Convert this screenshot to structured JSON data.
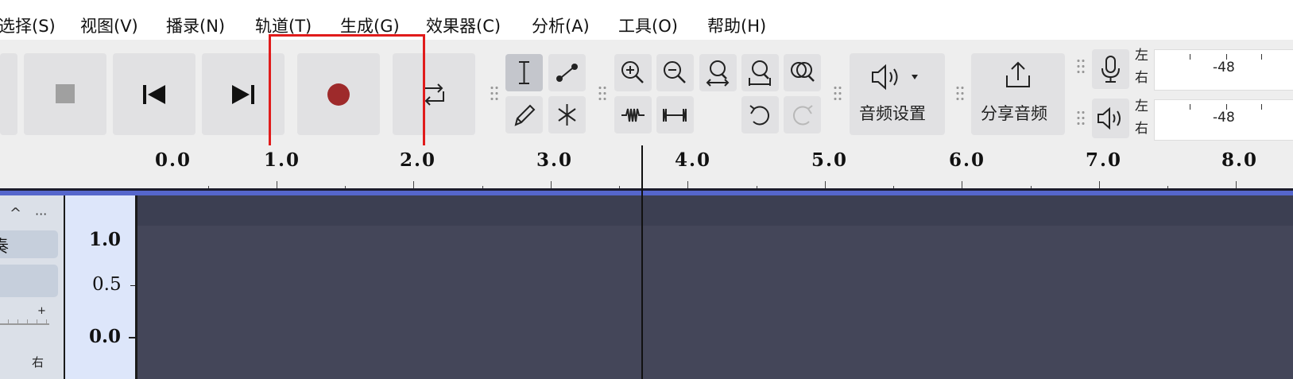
{
  "menu": {
    "items": [
      "选择(S)",
      "视图(V)",
      "播录(N)",
      "轨道(T)",
      "生成(G)",
      "效果器(C)",
      "分析(A)",
      "工具(O)",
      "帮助(H)"
    ]
  },
  "transport": {
    "buttons": [
      "stop",
      "skip-to-start",
      "skip-to-end",
      "record",
      "loop"
    ],
    "record_color": "#9e2a2b"
  },
  "tools": {
    "row1": [
      "select-tool",
      "envelope-tool"
    ],
    "row2": [
      "draw-tool",
      "multi-tool"
    ],
    "active": "select-tool"
  },
  "zoom": {
    "row1": [
      "zoom-in",
      "zoom-out",
      "fit-selection",
      "fit-project",
      "zoom-toggle"
    ],
    "row2": [
      "trim-audio",
      "silence-audio",
      "undo",
      "redo"
    ]
  },
  "audio_setup": {
    "label": "音频设置"
  },
  "share_audio": {
    "label": "分享音频"
  },
  "meters": {
    "record": {
      "left": "左",
      "right": "右",
      "value": "-48"
    },
    "play": {
      "left": "左",
      "right": "右",
      "value": "-48"
    }
  },
  "ruler": {
    "labels": [
      "0.0",
      "1.0",
      "2.0",
      "3.0",
      "4.0",
      "5.0",
      "6.0",
      "7.0",
      "8.0"
    ]
  },
  "track": {
    "name_partial": "奏",
    "pan_label_right": "右",
    "gain_plus": "+",
    "collapse": "^",
    "menu_dots": "···",
    "scale": [
      "1.0",
      "0.5",
      "0.0"
    ]
  },
  "colors": {
    "highlight": "#e01b1b",
    "timeline_blue": "#5566cc",
    "clip_bg": "#444659"
  }
}
